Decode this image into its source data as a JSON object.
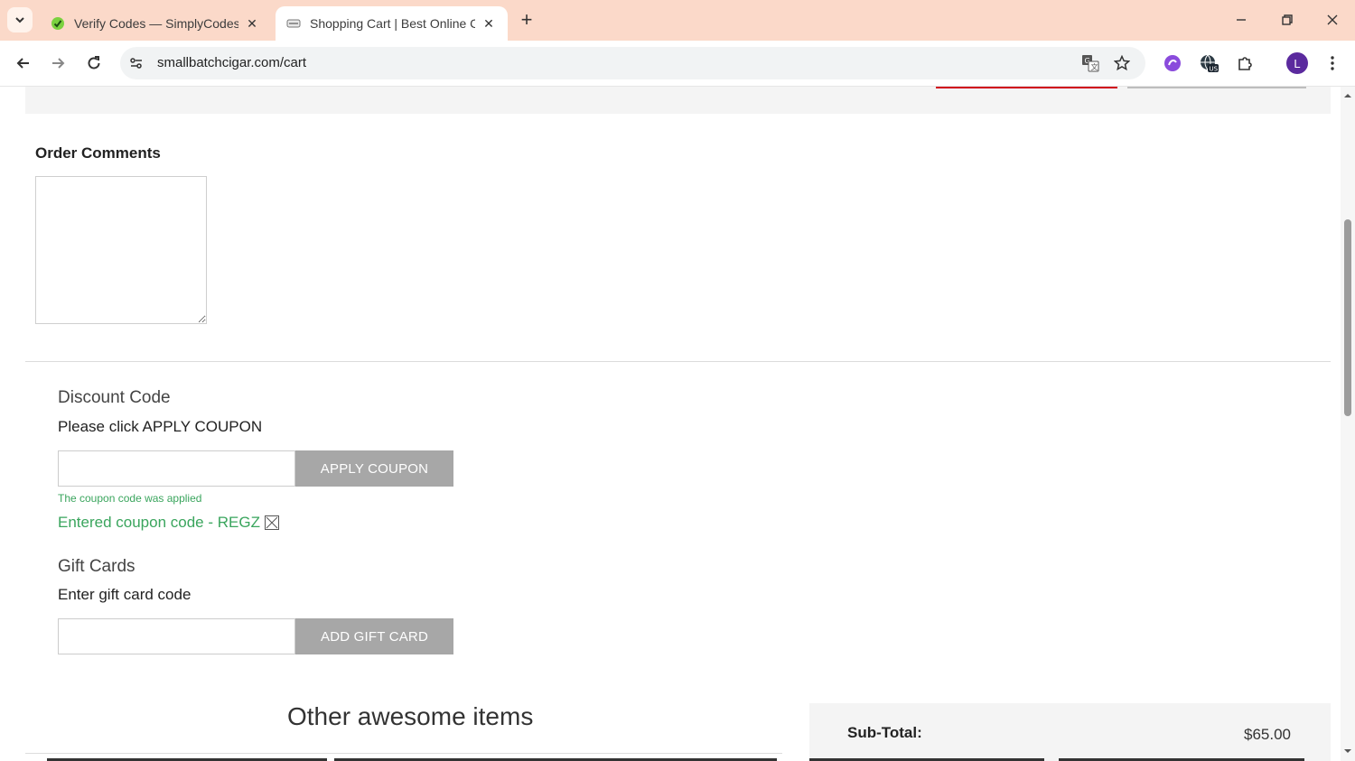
{
  "browser": {
    "tabs": [
      {
        "title": "Verify Codes — SimplyCodes",
        "active": false
      },
      {
        "title": "Shopping Cart | Best Online Cig",
        "active": true
      }
    ],
    "url": "smallbatchcigar.com/cart",
    "profile_initial": "L",
    "vpn_badge": "US"
  },
  "page": {
    "order_comments": {
      "title": "Order Comments",
      "value": ""
    },
    "discount": {
      "title": "Discount Code",
      "instruction": "Please click APPLY COUPON",
      "input_value": "",
      "button_label": "APPLY COUPON",
      "applied_message": "The coupon code was applied",
      "entered_code_text": "Entered coupon code - REGZ"
    },
    "gift_cards": {
      "title": "Gift Cards",
      "instruction": "Enter gift card code",
      "input_value": "",
      "button_label": "ADD GIFT CARD"
    },
    "other_items_title": "Other awesome items",
    "summary": {
      "subtotal_label": "Sub-Total:",
      "subtotal_value": "$65.00"
    }
  },
  "colors": {
    "tab_strip": "#fbd9c9",
    "success_text": "#3aa55d",
    "button_gray": "#a7a7a7",
    "accent_red": "#d0021b"
  }
}
